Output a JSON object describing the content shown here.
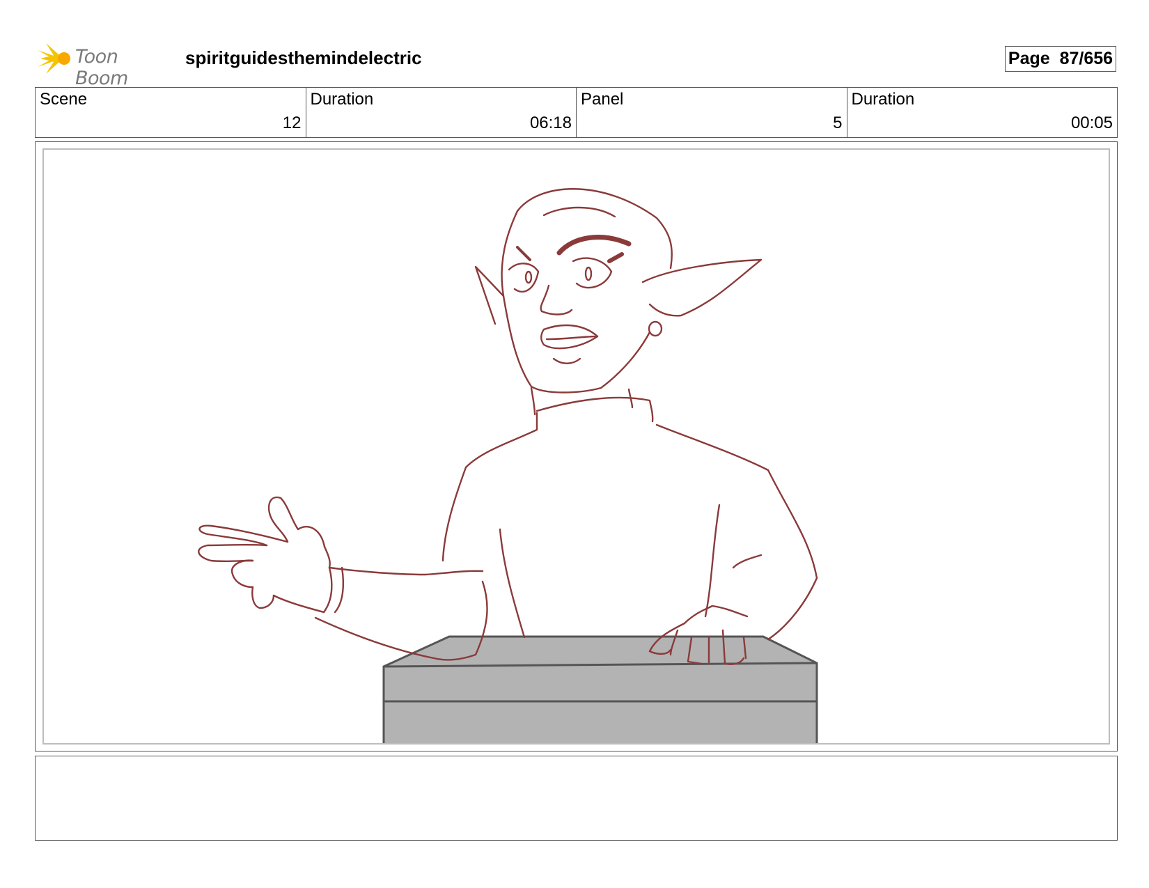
{
  "header": {
    "logo_text": "Toon Boom",
    "logo_icon": "burst-icon",
    "logo_color": "#f5c400",
    "project_title": "spiritguidesthemindelectric",
    "page_label": "Page",
    "page_number": "87/656"
  },
  "info": {
    "scene_label": "Scene",
    "scene_value": "12",
    "scene_duration_label": "Duration",
    "scene_duration_value": "06:18",
    "panel_label": "Panel",
    "panel_value": "5",
    "panel_duration_label": "Duration",
    "panel_duration_value": "00:05"
  },
  "panel": {
    "sketch_color": "#8b3a3a",
    "box_fill": "#b3b3b3",
    "box_stroke": "#555555"
  },
  "notes": {
    "text": ""
  }
}
